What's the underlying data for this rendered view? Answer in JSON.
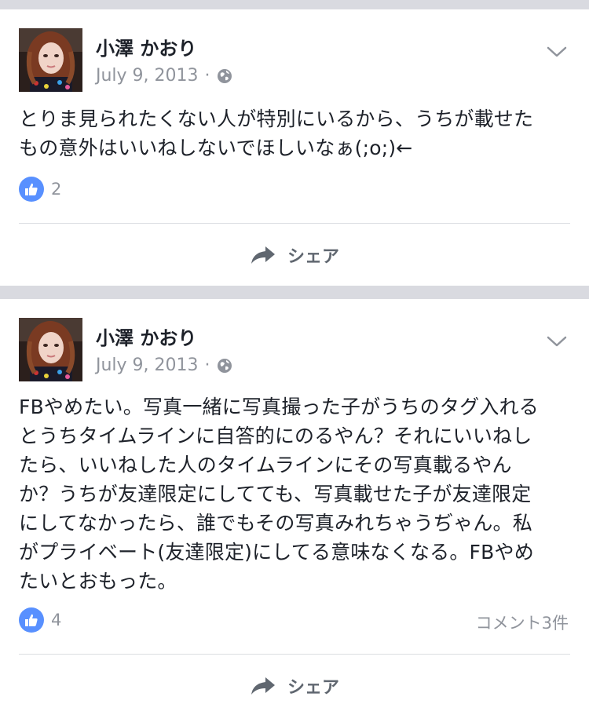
{
  "posts": [
    {
      "author": "小澤 かおり",
      "date": "July 9, 2013",
      "dot": "·",
      "privacy_icon": "globe-icon",
      "text": "とりま見られたくない人が特別にいるから、うちが載せた\nもの意外はいいねしないでほしいなぁ(;o;)←",
      "likes": "2",
      "comments": "",
      "share_label": "シェア"
    },
    {
      "author": "小澤 かおり",
      "date": "July 9, 2013",
      "dot": "·",
      "privacy_icon": "globe-icon",
      "text": "FBやめたい。写真一緒に写真撮った子がうちのタグ入れる\nとうちタイムラインに自答的にのるやん？それにいいねし\nたら、いいねした人のタイムラインにその写真載るやん\nか？うちが友達限定にしてても、写真載せた子が友達限定\nにしてなかったら、誰でもその写真みれちゃうぢゃん。私\nがプライベート(友達限定)にしてる意味なくなる。FBやめ\nたいとおもった。",
      "likes": "4",
      "comments": "コメント3件",
      "share_label": "シェア"
    }
  ],
  "colors": {
    "background": "#d9dae0",
    "card": "#ffffff",
    "like_blue": "#5890ff",
    "meta_gray": "#90949c",
    "text": "#1d2129"
  }
}
